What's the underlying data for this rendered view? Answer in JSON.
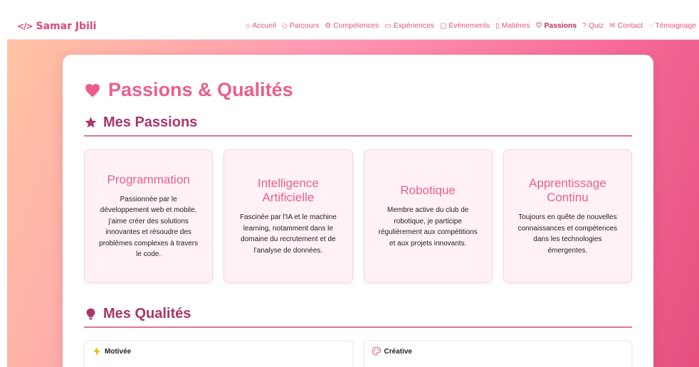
{
  "navbar": {
    "brand": "Samar Jbili",
    "brand_icon": "code-icon",
    "links": [
      {
        "label": "Accueil",
        "icon": "home-icon"
      },
      {
        "label": "Parcours",
        "icon": "graduation-icon"
      },
      {
        "label": "Compétences",
        "icon": "gear-icon"
      },
      {
        "label": "Expériences",
        "icon": "briefcase-icon"
      },
      {
        "label": "Evénements",
        "icon": "calendar-icon"
      },
      {
        "label": "Matières",
        "icon": "book-icon"
      },
      {
        "label": "Passions",
        "icon": "heart-icon",
        "active": true
      },
      {
        "label": "Quiz",
        "icon": "question-icon"
      },
      {
        "label": "Contact",
        "icon": "mail-icon"
      },
      {
        "label": "Témoignage",
        "icon": "chat-icon"
      }
    ]
  },
  "page": {
    "title": "Passions & Qualités",
    "title_icon": "heart-icon"
  },
  "passions": {
    "heading": "Mes Passions",
    "icon": "star-icon",
    "items": [
      {
        "title": "Programmation",
        "desc": "Passionnée par le développement web et mobile, j'aime créer des solutions innovantes et résoudre des problèmes complexes à travers le code."
      },
      {
        "title": "Intelligence Artificielle",
        "desc": "Fascinée par l'IA et le machine learning, notamment dans le domaine du recrutement et de l'analyse de données."
      },
      {
        "title": "Robotique",
        "desc": "Membre active du club de robotique, je participe régulièrement aux compétitions et aux projets innovants."
      },
      {
        "title": "Apprentissage Continu",
        "desc": "Toujours en quête de nouvelles connaissances et compétences dans les technologies émergentes."
      }
    ]
  },
  "qualites": {
    "heading": "Mes Qualités",
    "icon": "lightbulb-icon",
    "items": [
      {
        "title": "Motivée",
        "icon": "lightning-icon"
      },
      {
        "title": "Créative",
        "icon": "palette-icon"
      }
    ]
  },
  "colors": {
    "accent": "#ea5f8c",
    "heading": "#a9356a",
    "card_bg": "#fff1f5"
  }
}
